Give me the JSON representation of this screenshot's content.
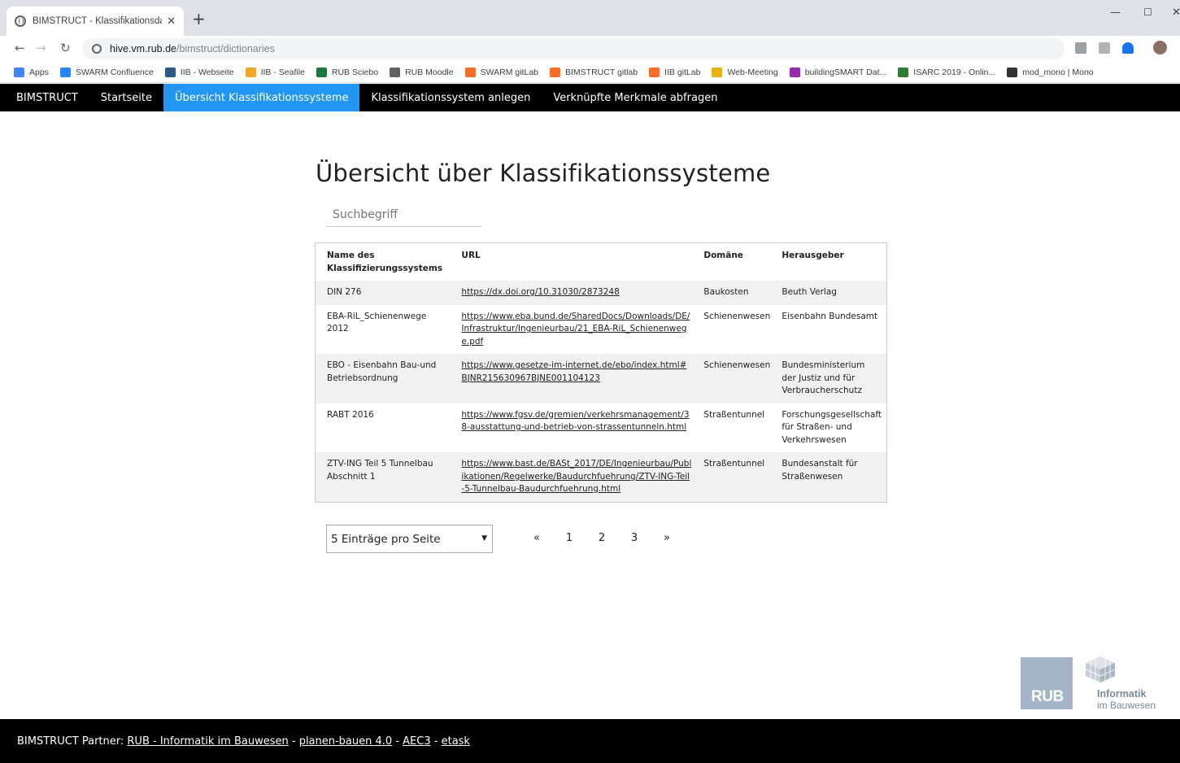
{
  "browser": {
    "tab_title": "BIMSTRUCT - Klassifikationsdate",
    "tab_close": "✕",
    "new_tab": "+",
    "url_host": "hive.vm.rub.de",
    "url_path": "/bimstruct/dictionaries",
    "bookmarks": [
      {
        "label": "Apps",
        "color": "#4285f4"
      },
      {
        "label": "SWARM Confluence",
        "color": "#2684ff"
      },
      {
        "label": "IIB - Webseite",
        "color": "#2c5a8a"
      },
      {
        "label": "IIB - Seafile",
        "color": "#f5a623"
      },
      {
        "label": "RUB Sciebo",
        "color": "#1a7a3c"
      },
      {
        "label": "RUB Moodle",
        "color": "#5f6368"
      },
      {
        "label": "SWARM gitLab",
        "color": "#fc6d26"
      },
      {
        "label": "BIMSTRUCT gitlab",
        "color": "#fc6d26"
      },
      {
        "label": "IIB gitLab",
        "color": "#fc6d26"
      },
      {
        "label": "Web-Meeting",
        "color": "#e8b400"
      },
      {
        "label": "buildingSMART Dat...",
        "color": "#9c27b0"
      },
      {
        "label": "ISARC 2019 - Onlin...",
        "color": "#2e7d32"
      },
      {
        "label": "mod_mono | Mono",
        "color": "#333333"
      }
    ]
  },
  "navbar": {
    "brand": "BIMSTRUCT",
    "items": [
      "Startseite",
      "Übersicht Klassifikationssysteme",
      "Klassifikationssystem anlegen",
      "Verknüpfte Merkmale abfragen"
    ]
  },
  "main": {
    "title": "Übersicht über Klassifikationssysteme",
    "search_placeholder": "Suchbegriff",
    "table": {
      "headers": [
        "Name des Klassifizierungssystems",
        "URL",
        "Domäne",
        "Herausgeber"
      ],
      "rows": [
        {
          "name": "DIN 276",
          "url": "https://dx.doi.org/10.31030/2873248",
          "domain": "Baukosten",
          "publisher": "Beuth Verlag"
        },
        {
          "name": "EBA-RiL_Schienenwege 2012",
          "url": "https://www.eba.bund.de/SharedDocs/Downloads/DE/Infrastruktur/Ingenieurbau/21_EBA-RiL_Schienenwege.pdf",
          "domain": "Schienenwesen",
          "publisher": "Eisenbahn Bundesamt"
        },
        {
          "name": "EBO - Eisenbahn Bau-und Betriebsordnung",
          "url": "https://www.gesetze-im-internet.de/ebo/index.html#BJNR215630967BJNE001104123",
          "domain": "Schienenwesen",
          "publisher": "Bundesministerium der Justiz und für Verbraucherschutz"
        },
        {
          "name": "RABT 2016",
          "url": "https://www.fgsv.de/gremien/verkehrsmanagement/38-ausstattung-und-betrieb-von-strassentunneln.html",
          "domain": "Straßentunnel",
          "publisher": "Forschungsgesellschaft für Straßen- und Verkehrswesen"
        },
        {
          "name": "ZTV-ING Teil 5 Tunnelbau Abschnitt 1",
          "url": "https://www.bast.de/BASt_2017/DE/Ingenieurbau/Publikationen/Regelwerke/Baudurchfuehrung/ZTV-ING-Teil-5-Tunnelbau-Baudurchfuehrung.html",
          "domain": "Straßentunnel",
          "publisher": "Bundesanstalt für Straßenwesen"
        }
      ]
    },
    "page_size": "5 Einträge pro Seite",
    "pager": [
      "«",
      "1",
      "2",
      "3",
      "»"
    ]
  },
  "logo": {
    "rub": "RUB",
    "line1": "Informatik",
    "line2": "im Bauwesen"
  },
  "footer": {
    "prefix": "BIMSTRUCT Partner: ",
    "links": [
      "RUB - Informatik im Bauwesen",
      "planen-bauen 4.0",
      "AEC3",
      "etask"
    ],
    "separator": " - "
  }
}
